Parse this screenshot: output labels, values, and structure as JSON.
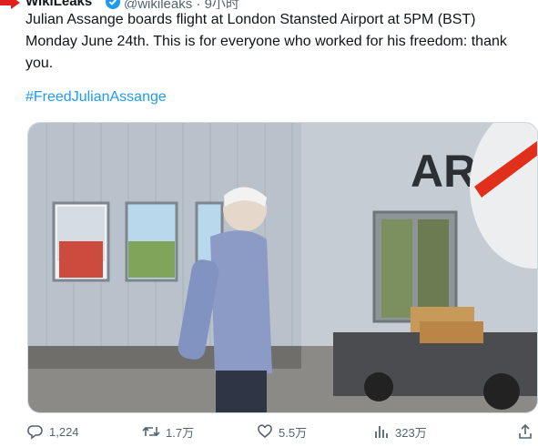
{
  "tweet": {
    "author_name": "WikiLeaks",
    "author_handle": "@wikileaks · 9小时",
    "text": "Julian Assange boards flight at London Stansted Airport at 5PM (BST) Monday June 24th. This is for everyone who worked for his freedom: thank you.",
    "hashtag": "#FreedJulianAssange"
  },
  "media": {
    "building_sign": "AR"
  },
  "actions": {
    "replies": "1,224",
    "retweets": "1.7万",
    "likes": "5.5万",
    "views": "323万"
  },
  "icons": {
    "arrow": "red-arrow-icon",
    "verified": "verified-badge-icon",
    "reply": "reply-icon",
    "retweet": "retweet-icon",
    "like": "heart-icon",
    "views": "views-icon",
    "share": "share-icon"
  },
  "colors": {
    "accent": "#1d9bf0",
    "verified": "#1d9bf0",
    "muted": "#536471",
    "marker": "#e0201c"
  }
}
